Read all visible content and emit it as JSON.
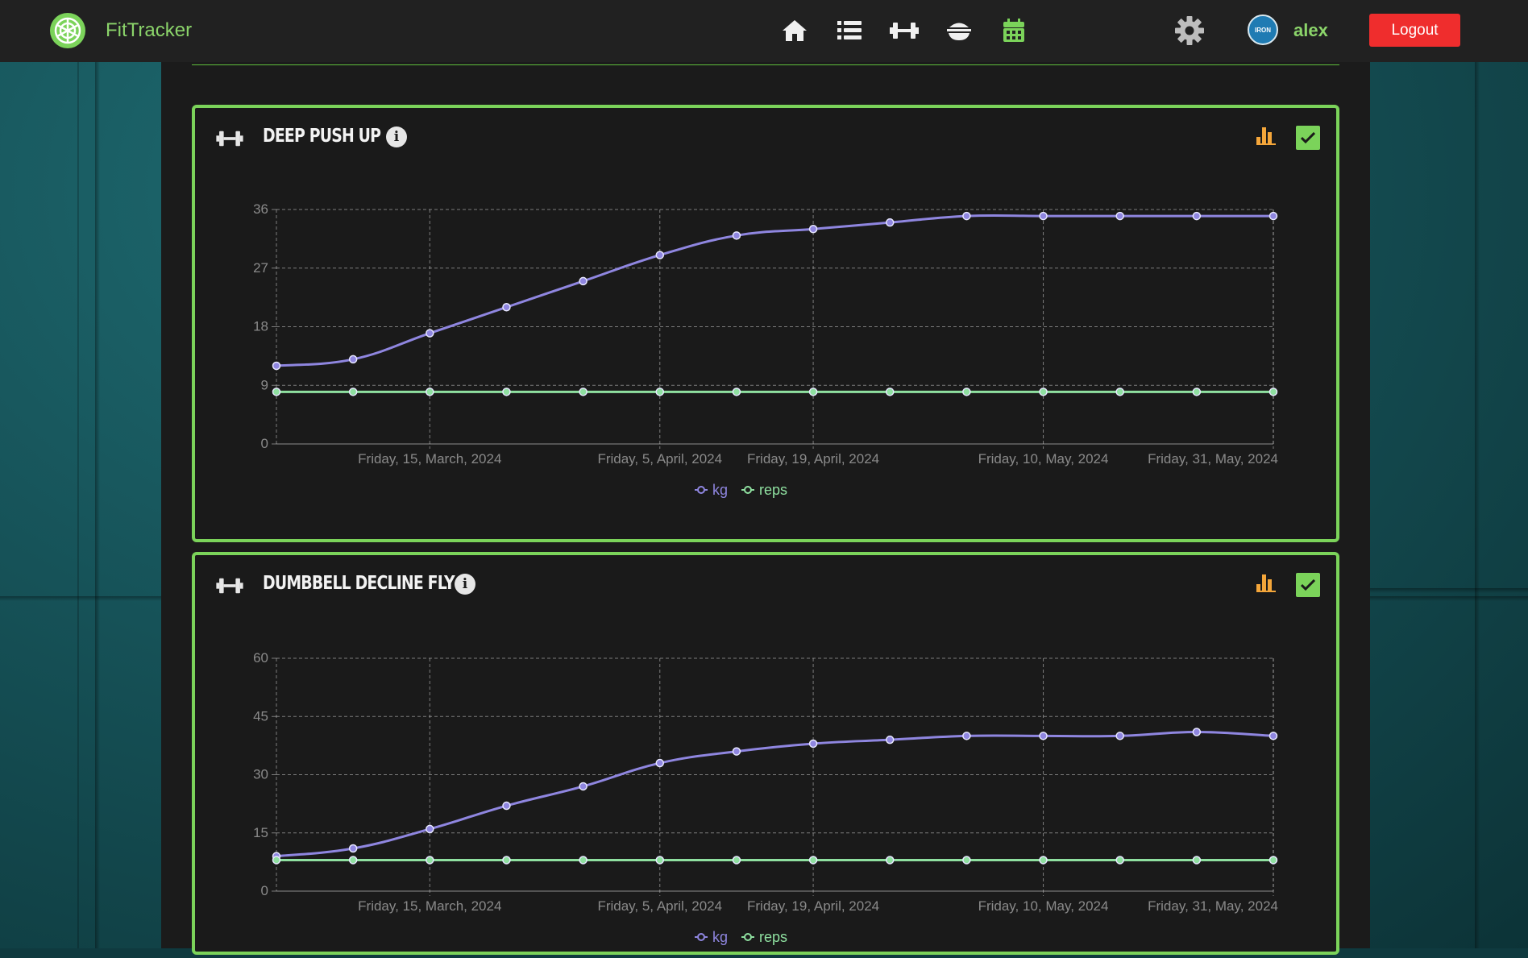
{
  "app": {
    "brand": "FitTracker"
  },
  "nav": {
    "icons": [
      "home-icon",
      "list-icon",
      "dumbbell-icon",
      "food-bowl-icon",
      "calendar-icon"
    ],
    "active_color": "#7bd35a"
  },
  "user": {
    "name": "alex",
    "avatar_text": "IRON",
    "logout_label": "Logout"
  },
  "colors": {
    "accent": "#7bd35a",
    "kg_series": "#8f86e0",
    "reps_series": "#8fe0a0",
    "logout": "#ef2d2d"
  },
  "cards": [
    {
      "title": "DEEP PUSH UP"
    },
    {
      "title": "DUMBBELL DECLINE FLY"
    }
  ],
  "chart_data": [
    {
      "type": "line",
      "title": "DEEP PUSH UP",
      "x": [
        "2024-03-01",
        "2024-03-08",
        "2024-03-15",
        "2024-03-22",
        "2024-03-29",
        "2024-04-05",
        "2024-04-12",
        "2024-04-19",
        "2024-04-26",
        "2024-05-03",
        "2024-05-10",
        "2024-05-17",
        "2024-05-24",
        "2024-05-31"
      ],
      "x_tick_labels": [
        "Friday, 15, March, 2024",
        "Friday, 5, April, 2024",
        "Friday, 19, April, 2024",
        "Friday, 10, May, 2024",
        "Friday, 31, May, 2024"
      ],
      "y_ticks": [
        0,
        9,
        18,
        27,
        36
      ],
      "ylim": [
        0,
        36
      ],
      "series": [
        {
          "name": "kg",
          "values": [
            12,
            13,
            17,
            21,
            25,
            29,
            32,
            33,
            34,
            35,
            35,
            35,
            35,
            35
          ]
        },
        {
          "name": "reps",
          "values": [
            8,
            8,
            8,
            8,
            8,
            8,
            8,
            8,
            8,
            8,
            8,
            8,
            8,
            8
          ]
        }
      ],
      "grid": true,
      "legend": "bottom-center"
    },
    {
      "type": "line",
      "title": "DUMBBELL DECLINE FLY",
      "x": [
        "2024-03-01",
        "2024-03-08",
        "2024-03-15",
        "2024-03-22",
        "2024-03-29",
        "2024-04-05",
        "2024-04-12",
        "2024-04-19",
        "2024-04-26",
        "2024-05-03",
        "2024-05-10",
        "2024-05-17",
        "2024-05-24",
        "2024-05-31"
      ],
      "x_tick_labels": [
        "Friday, 15, March, 2024",
        "Friday, 5, April, 2024",
        "Friday, 19, April, 2024",
        "Friday, 10, May, 2024",
        "Friday, 31, May, 2024"
      ],
      "y_ticks": [
        0,
        15,
        30,
        45,
        60
      ],
      "ylim": [
        0,
        60
      ],
      "series": [
        {
          "name": "kg",
          "values": [
            9,
            11,
            16,
            22,
            27,
            33,
            36,
            38,
            39,
            40,
            40,
            40,
            41,
            40
          ]
        },
        {
          "name": "reps",
          "values": [
            8,
            8,
            8,
            8,
            8,
            8,
            8,
            8,
            8,
            8,
            8,
            8,
            8,
            8
          ]
        }
      ],
      "grid": true,
      "legend": "bottom-center"
    }
  ]
}
